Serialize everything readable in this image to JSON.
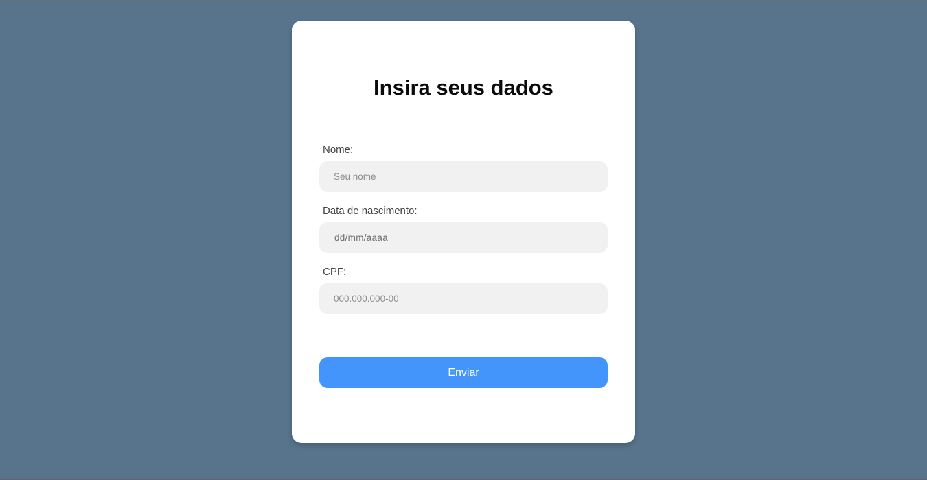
{
  "form": {
    "title": "Insira seus dados",
    "fields": [
      {
        "label": "Nome:",
        "placeholder": "Seu nome"
      },
      {
        "label": "Data de nascimento:",
        "placeholder": "dd/mm/aaaa"
      },
      {
        "label": "CPF:",
        "placeholder": "000.000.000-00"
      }
    ],
    "submit_label": "Enviar"
  },
  "colors": {
    "background": "#58748c",
    "card": "#ffffff",
    "input_bg": "#f1f1f1",
    "button": "#4495fb"
  }
}
